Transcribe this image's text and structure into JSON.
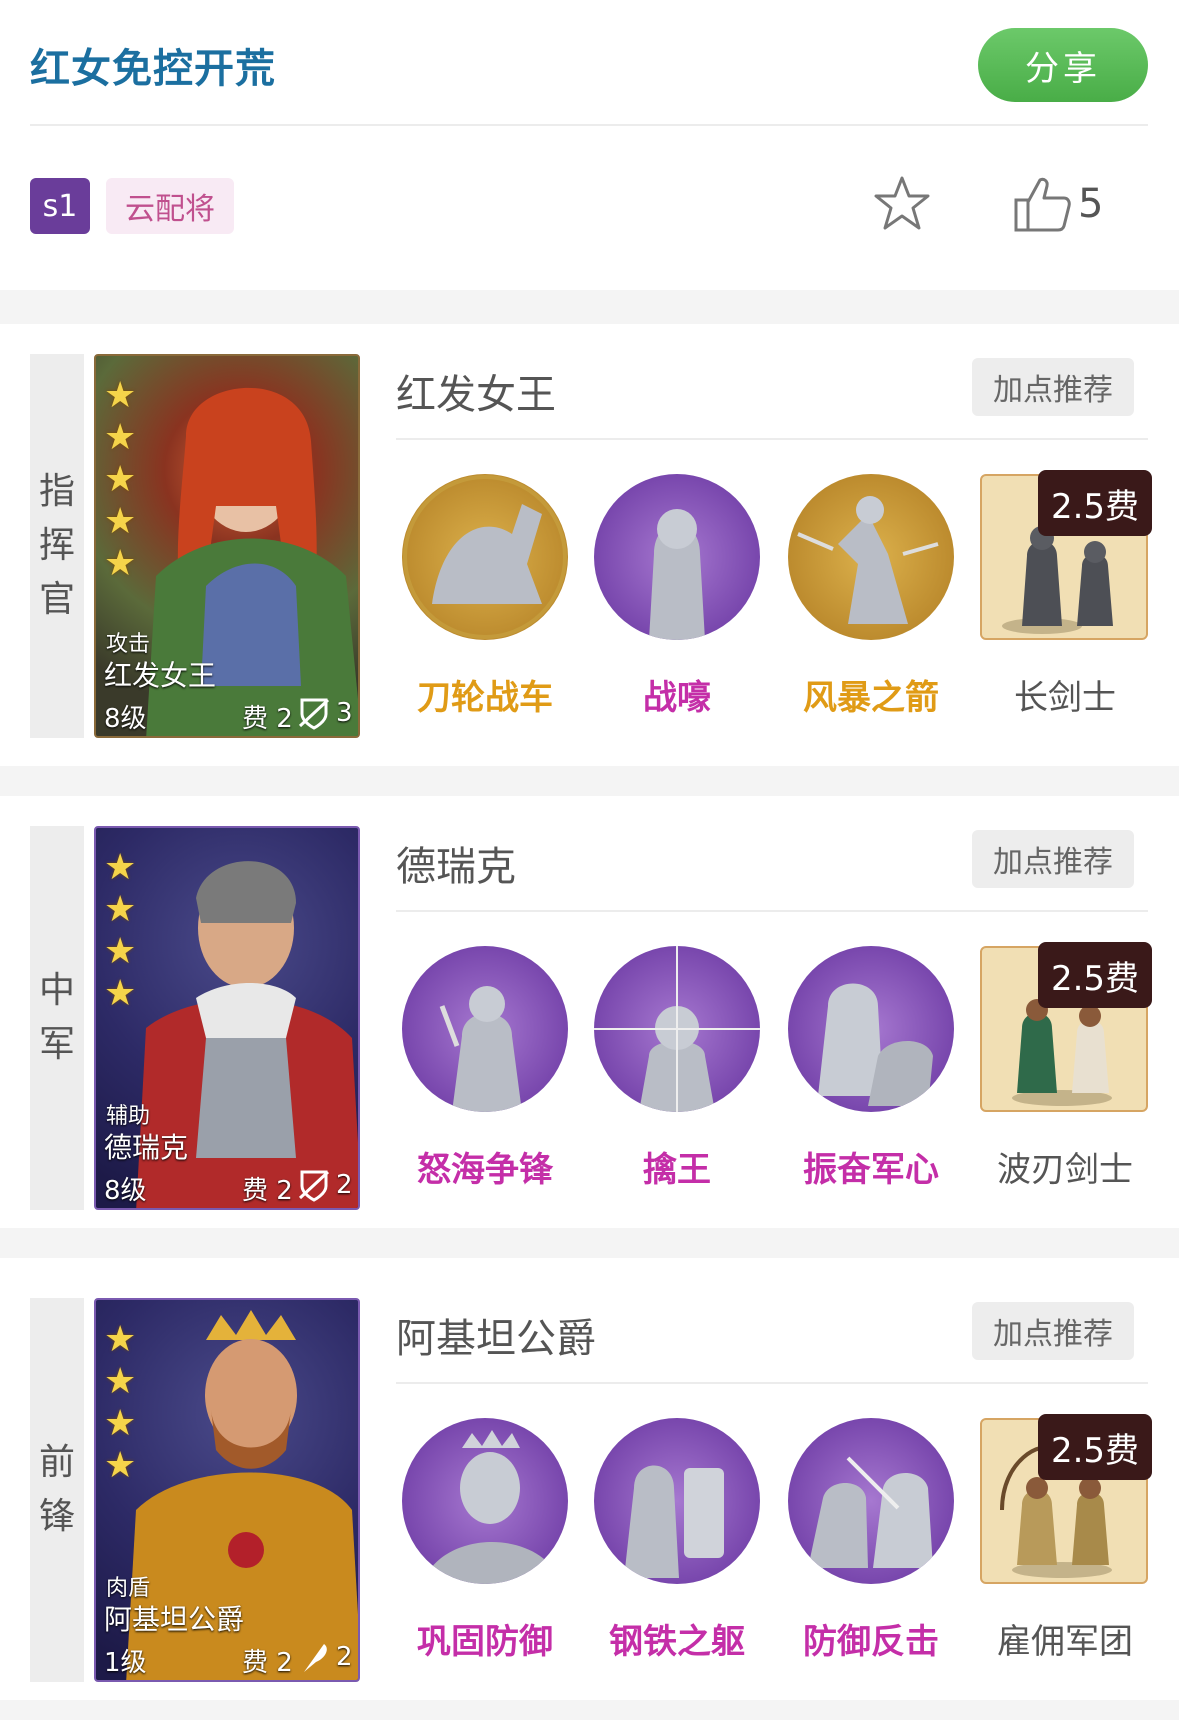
{
  "header": {
    "title": "红女免控开荒",
    "share_label": "分享",
    "season_tag": "s1",
    "type_tag": "云配将",
    "like_count": "5"
  },
  "colors": {
    "title": "#1b6fa0",
    "share": "#55b553",
    "season_tag": "#6a3d9a",
    "gold_skill": "#e09b16",
    "purple_skill": "#c42ea8"
  },
  "generals": [
    {
      "position_label": [
        "指",
        "挥",
        "官"
      ],
      "name": "红发女王",
      "card": {
        "role_type": "攻击",
        "name": "红发女王",
        "level": "8级",
        "cost": "费 2",
        "unit_count": "3",
        "stars": 5
      },
      "recommend_label": "加点推荐",
      "skills": [
        {
          "name": "刀轮战车",
          "color": "gold"
        },
        {
          "name": "战嚎",
          "color": "magenta"
        },
        {
          "name": "风暴之箭",
          "color": "gold"
        }
      ],
      "troop": {
        "name": "长剑士",
        "cost": "2.5费"
      }
    },
    {
      "position_label": [
        "中",
        "军"
      ],
      "name": "德瑞克",
      "card": {
        "role_type": "辅助",
        "name": "德瑞克",
        "level": "8级",
        "cost": "费 2",
        "unit_count": "2",
        "stars": 4
      },
      "recommend_label": "加点推荐",
      "skills": [
        {
          "name": "怒海争锋",
          "color": "magenta"
        },
        {
          "name": "擒王",
          "color": "magenta"
        },
        {
          "name": "振奋军心",
          "color": "magenta"
        }
      ],
      "troop": {
        "name": "波刃剑士",
        "cost": "2.5费"
      }
    },
    {
      "position_label": [
        "前",
        "锋"
      ],
      "name": "阿基坦公爵",
      "card": {
        "role_type": "肉盾",
        "name": "阿基坦公爵",
        "level": "1级",
        "cost": "费 2",
        "unit_count": "2",
        "stars": 4
      },
      "recommend_label": "加点推荐",
      "skills": [
        {
          "name": "巩固防御",
          "color": "magenta"
        },
        {
          "name": "钢铁之躯",
          "color": "magenta"
        },
        {
          "name": "防御反击",
          "color": "magenta"
        }
      ],
      "troop": {
        "name": "雇佣军团",
        "cost": "2.5费"
      }
    }
  ]
}
